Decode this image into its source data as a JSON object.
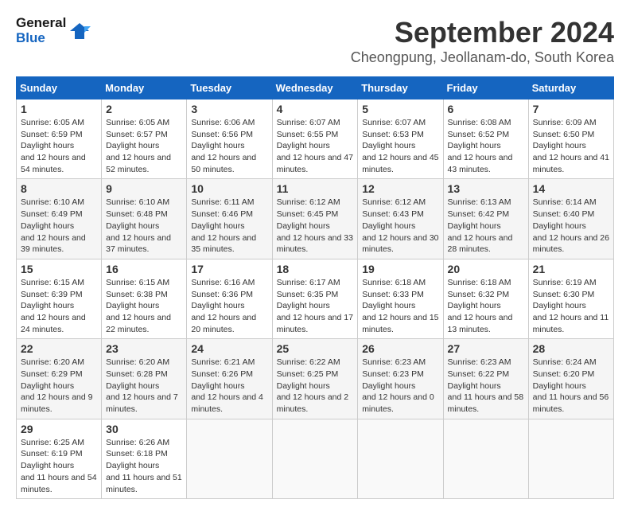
{
  "logo": {
    "line1": "General",
    "line2": "Blue"
  },
  "title": "September 2024",
  "location": "Cheongpung, Jeollanam-do, South Korea",
  "days_of_week": [
    "Sunday",
    "Monday",
    "Tuesday",
    "Wednesday",
    "Thursday",
    "Friday",
    "Saturday"
  ],
  "weeks": [
    [
      {
        "day": "1",
        "sunrise": "6:05 AM",
        "sunset": "6:59 PM",
        "daylight": "12 hours and 54 minutes."
      },
      {
        "day": "2",
        "sunrise": "6:05 AM",
        "sunset": "6:57 PM",
        "daylight": "12 hours and 52 minutes."
      },
      {
        "day": "3",
        "sunrise": "6:06 AM",
        "sunset": "6:56 PM",
        "daylight": "12 hours and 50 minutes."
      },
      {
        "day": "4",
        "sunrise": "6:07 AM",
        "sunset": "6:55 PM",
        "daylight": "12 hours and 47 minutes."
      },
      {
        "day": "5",
        "sunrise": "6:07 AM",
        "sunset": "6:53 PM",
        "daylight": "12 hours and 45 minutes."
      },
      {
        "day": "6",
        "sunrise": "6:08 AM",
        "sunset": "6:52 PM",
        "daylight": "12 hours and 43 minutes."
      },
      {
        "day": "7",
        "sunrise": "6:09 AM",
        "sunset": "6:50 PM",
        "daylight": "12 hours and 41 minutes."
      }
    ],
    [
      {
        "day": "8",
        "sunrise": "6:10 AM",
        "sunset": "6:49 PM",
        "daylight": "12 hours and 39 minutes."
      },
      {
        "day": "9",
        "sunrise": "6:10 AM",
        "sunset": "6:48 PM",
        "daylight": "12 hours and 37 minutes."
      },
      {
        "day": "10",
        "sunrise": "6:11 AM",
        "sunset": "6:46 PM",
        "daylight": "12 hours and 35 minutes."
      },
      {
        "day": "11",
        "sunrise": "6:12 AM",
        "sunset": "6:45 PM",
        "daylight": "12 hours and 33 minutes."
      },
      {
        "day": "12",
        "sunrise": "6:12 AM",
        "sunset": "6:43 PM",
        "daylight": "12 hours and 30 minutes."
      },
      {
        "day": "13",
        "sunrise": "6:13 AM",
        "sunset": "6:42 PM",
        "daylight": "12 hours and 28 minutes."
      },
      {
        "day": "14",
        "sunrise": "6:14 AM",
        "sunset": "6:40 PM",
        "daylight": "12 hours and 26 minutes."
      }
    ],
    [
      {
        "day": "15",
        "sunrise": "6:15 AM",
        "sunset": "6:39 PM",
        "daylight": "12 hours and 24 minutes."
      },
      {
        "day": "16",
        "sunrise": "6:15 AM",
        "sunset": "6:38 PM",
        "daylight": "12 hours and 22 minutes."
      },
      {
        "day": "17",
        "sunrise": "6:16 AM",
        "sunset": "6:36 PM",
        "daylight": "12 hours and 20 minutes."
      },
      {
        "day": "18",
        "sunrise": "6:17 AM",
        "sunset": "6:35 PM",
        "daylight": "12 hours and 17 minutes."
      },
      {
        "day": "19",
        "sunrise": "6:18 AM",
        "sunset": "6:33 PM",
        "daylight": "12 hours and 15 minutes."
      },
      {
        "day": "20",
        "sunrise": "6:18 AM",
        "sunset": "6:32 PM",
        "daylight": "12 hours and 13 minutes."
      },
      {
        "day": "21",
        "sunrise": "6:19 AM",
        "sunset": "6:30 PM",
        "daylight": "12 hours and 11 minutes."
      }
    ],
    [
      {
        "day": "22",
        "sunrise": "6:20 AM",
        "sunset": "6:29 PM",
        "daylight": "12 hours and 9 minutes."
      },
      {
        "day": "23",
        "sunrise": "6:20 AM",
        "sunset": "6:28 PM",
        "daylight": "12 hours and 7 minutes."
      },
      {
        "day": "24",
        "sunrise": "6:21 AM",
        "sunset": "6:26 PM",
        "daylight": "12 hours and 4 minutes."
      },
      {
        "day": "25",
        "sunrise": "6:22 AM",
        "sunset": "6:25 PM",
        "daylight": "12 hours and 2 minutes."
      },
      {
        "day": "26",
        "sunrise": "6:23 AM",
        "sunset": "6:23 PM",
        "daylight": "12 hours and 0 minutes."
      },
      {
        "day": "27",
        "sunrise": "6:23 AM",
        "sunset": "6:22 PM",
        "daylight": "11 hours and 58 minutes."
      },
      {
        "day": "28",
        "sunrise": "6:24 AM",
        "sunset": "6:20 PM",
        "daylight": "11 hours and 56 minutes."
      }
    ],
    [
      {
        "day": "29",
        "sunrise": "6:25 AM",
        "sunset": "6:19 PM",
        "daylight": "11 hours and 54 minutes."
      },
      {
        "day": "30",
        "sunrise": "6:26 AM",
        "sunset": "6:18 PM",
        "daylight": "11 hours and 51 minutes."
      },
      null,
      null,
      null,
      null,
      null
    ]
  ]
}
